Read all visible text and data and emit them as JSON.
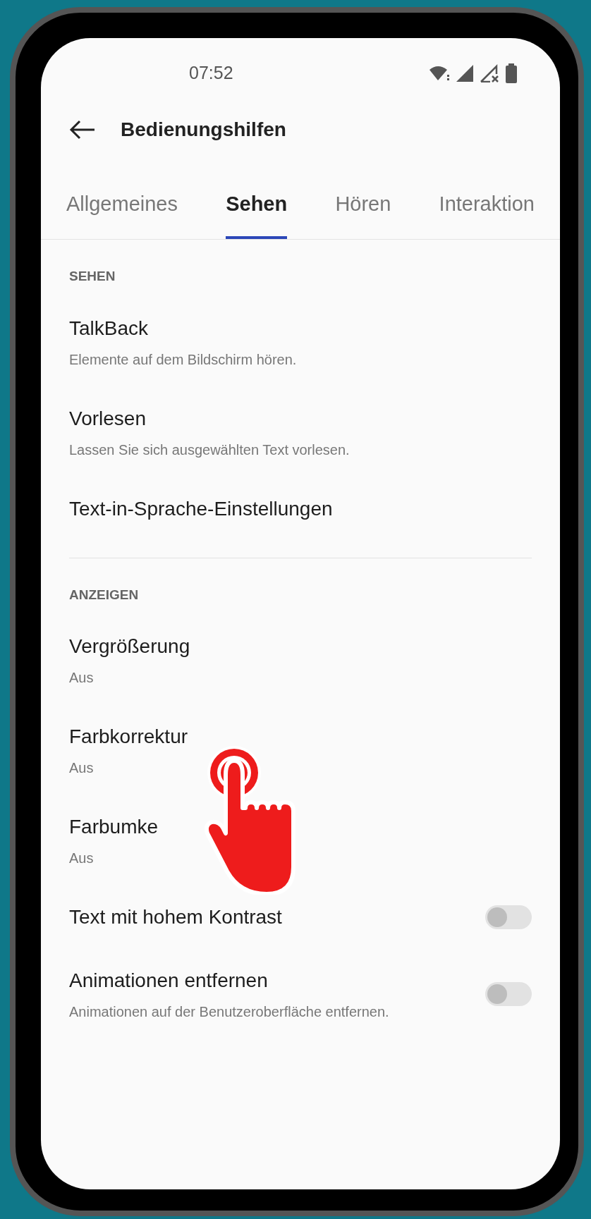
{
  "status_bar": {
    "time": "07:52"
  },
  "header": {
    "title": "Bedienungshilfen"
  },
  "tabs": [
    {
      "label": "Allgemeines",
      "selected": false
    },
    {
      "label": "Sehen",
      "selected": true
    },
    {
      "label": "Hören",
      "selected": false
    },
    {
      "label": "Interaktion",
      "selected": false
    }
  ],
  "sections": [
    {
      "heading": "SEHEN",
      "items": [
        {
          "kind": "nav",
          "title": "TalkBack",
          "subtitle": "Elemente auf dem Bildschirm hören."
        },
        {
          "kind": "nav",
          "title": "Vorlesen",
          "subtitle": "Lassen Sie sich ausgewählten Text vorlesen."
        },
        {
          "kind": "nav",
          "title": "Text-in-Sprache-Einstellungen"
        }
      ]
    },
    {
      "heading": "ANZEIGEN",
      "items": [
        {
          "kind": "nav",
          "title": "Vergrößerung",
          "subtitle": "Aus"
        },
        {
          "kind": "nav",
          "title": "Farbkorrektur",
          "subtitle": "Aus"
        },
        {
          "kind": "nav",
          "title": "Farbumke",
          "subtitle": "Aus"
        },
        {
          "kind": "toggle",
          "title": "Text mit hohem Kontrast",
          "on": false
        },
        {
          "kind": "toggle",
          "title": "Animationen entfernen",
          "subtitle": "Animationen auf der Benutzeroberfläche entfernen.",
          "on": false
        }
      ]
    }
  ]
}
